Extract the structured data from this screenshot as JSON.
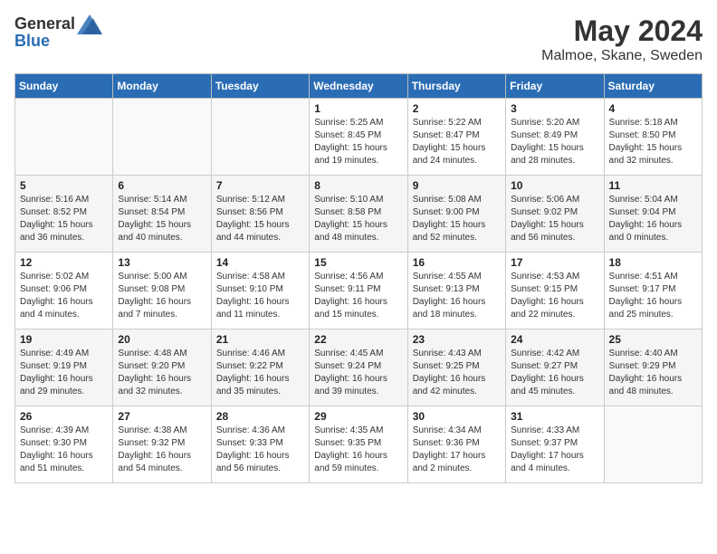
{
  "header": {
    "logo_general": "General",
    "logo_blue": "Blue",
    "month": "May 2024",
    "location": "Malmoe, Skane, Sweden"
  },
  "weekdays": [
    "Sunday",
    "Monday",
    "Tuesday",
    "Wednesday",
    "Thursday",
    "Friday",
    "Saturday"
  ],
  "weeks": [
    [
      {
        "day": "",
        "info": ""
      },
      {
        "day": "",
        "info": ""
      },
      {
        "day": "",
        "info": ""
      },
      {
        "day": "1",
        "info": "Sunrise: 5:25 AM\nSunset: 8:45 PM\nDaylight: 15 hours\nand 19 minutes."
      },
      {
        "day": "2",
        "info": "Sunrise: 5:22 AM\nSunset: 8:47 PM\nDaylight: 15 hours\nand 24 minutes."
      },
      {
        "day": "3",
        "info": "Sunrise: 5:20 AM\nSunset: 8:49 PM\nDaylight: 15 hours\nand 28 minutes."
      },
      {
        "day": "4",
        "info": "Sunrise: 5:18 AM\nSunset: 8:50 PM\nDaylight: 15 hours\nand 32 minutes."
      }
    ],
    [
      {
        "day": "5",
        "info": "Sunrise: 5:16 AM\nSunset: 8:52 PM\nDaylight: 15 hours\nand 36 minutes."
      },
      {
        "day": "6",
        "info": "Sunrise: 5:14 AM\nSunset: 8:54 PM\nDaylight: 15 hours\nand 40 minutes."
      },
      {
        "day": "7",
        "info": "Sunrise: 5:12 AM\nSunset: 8:56 PM\nDaylight: 15 hours\nand 44 minutes."
      },
      {
        "day": "8",
        "info": "Sunrise: 5:10 AM\nSunset: 8:58 PM\nDaylight: 15 hours\nand 48 minutes."
      },
      {
        "day": "9",
        "info": "Sunrise: 5:08 AM\nSunset: 9:00 PM\nDaylight: 15 hours\nand 52 minutes."
      },
      {
        "day": "10",
        "info": "Sunrise: 5:06 AM\nSunset: 9:02 PM\nDaylight: 15 hours\nand 56 minutes."
      },
      {
        "day": "11",
        "info": "Sunrise: 5:04 AM\nSunset: 9:04 PM\nDaylight: 16 hours\nand 0 minutes."
      }
    ],
    [
      {
        "day": "12",
        "info": "Sunrise: 5:02 AM\nSunset: 9:06 PM\nDaylight: 16 hours\nand 4 minutes."
      },
      {
        "day": "13",
        "info": "Sunrise: 5:00 AM\nSunset: 9:08 PM\nDaylight: 16 hours\nand 7 minutes."
      },
      {
        "day": "14",
        "info": "Sunrise: 4:58 AM\nSunset: 9:10 PM\nDaylight: 16 hours\nand 11 minutes."
      },
      {
        "day": "15",
        "info": "Sunrise: 4:56 AM\nSunset: 9:11 PM\nDaylight: 16 hours\nand 15 minutes."
      },
      {
        "day": "16",
        "info": "Sunrise: 4:55 AM\nSunset: 9:13 PM\nDaylight: 16 hours\nand 18 minutes."
      },
      {
        "day": "17",
        "info": "Sunrise: 4:53 AM\nSunset: 9:15 PM\nDaylight: 16 hours\nand 22 minutes."
      },
      {
        "day": "18",
        "info": "Sunrise: 4:51 AM\nSunset: 9:17 PM\nDaylight: 16 hours\nand 25 minutes."
      }
    ],
    [
      {
        "day": "19",
        "info": "Sunrise: 4:49 AM\nSunset: 9:19 PM\nDaylight: 16 hours\nand 29 minutes."
      },
      {
        "day": "20",
        "info": "Sunrise: 4:48 AM\nSunset: 9:20 PM\nDaylight: 16 hours\nand 32 minutes."
      },
      {
        "day": "21",
        "info": "Sunrise: 4:46 AM\nSunset: 9:22 PM\nDaylight: 16 hours\nand 35 minutes."
      },
      {
        "day": "22",
        "info": "Sunrise: 4:45 AM\nSunset: 9:24 PM\nDaylight: 16 hours\nand 39 minutes."
      },
      {
        "day": "23",
        "info": "Sunrise: 4:43 AM\nSunset: 9:25 PM\nDaylight: 16 hours\nand 42 minutes."
      },
      {
        "day": "24",
        "info": "Sunrise: 4:42 AM\nSunset: 9:27 PM\nDaylight: 16 hours\nand 45 minutes."
      },
      {
        "day": "25",
        "info": "Sunrise: 4:40 AM\nSunset: 9:29 PM\nDaylight: 16 hours\nand 48 minutes."
      }
    ],
    [
      {
        "day": "26",
        "info": "Sunrise: 4:39 AM\nSunset: 9:30 PM\nDaylight: 16 hours\nand 51 minutes."
      },
      {
        "day": "27",
        "info": "Sunrise: 4:38 AM\nSunset: 9:32 PM\nDaylight: 16 hours\nand 54 minutes."
      },
      {
        "day": "28",
        "info": "Sunrise: 4:36 AM\nSunset: 9:33 PM\nDaylight: 16 hours\nand 56 minutes."
      },
      {
        "day": "29",
        "info": "Sunrise: 4:35 AM\nSunset: 9:35 PM\nDaylight: 16 hours\nand 59 minutes."
      },
      {
        "day": "30",
        "info": "Sunrise: 4:34 AM\nSunset: 9:36 PM\nDaylight: 17 hours\nand 2 minutes."
      },
      {
        "day": "31",
        "info": "Sunrise: 4:33 AM\nSunset: 9:37 PM\nDaylight: 17 hours\nand 4 minutes."
      },
      {
        "day": "",
        "info": ""
      }
    ]
  ]
}
